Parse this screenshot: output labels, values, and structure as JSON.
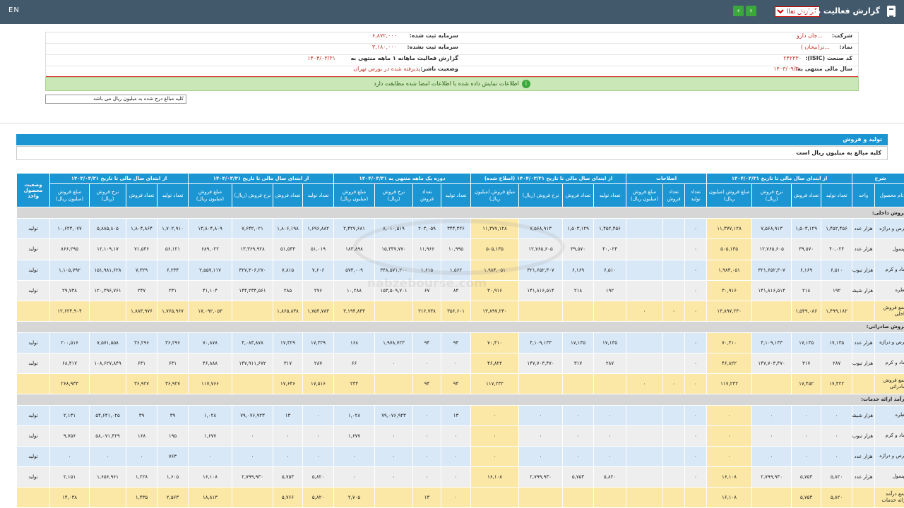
{
  "topbar": {
    "lang": "EN",
    "title": "گزارش فعالیت ماهانه",
    "report_select": "گزارش تغالیب",
    "prev": "‹",
    "next": "›"
  },
  "info": {
    "company_label": "شرکت:",
    "company_value": "...جان دارو",
    "capital_reg_label": "سرمایه ثبت شده:",
    "capital_reg_value": "۶,۸۷۲,۰۰۰",
    "symbol_label": "نماد:",
    "symbol_value": "...تر(بیجان )",
    "capital_unreg_label": "سرمایه ثبت نشده:",
    "capital_unreg_value": "۳,۱۸۰,۰۰۰",
    "isic_label": "کد صنعت (ISIC):",
    "isic_value": "۲۴۲۳۳۰",
    "report_label": "گزارش فعالیت ماهانه ۱ ماهه منتهی به",
    "report_value": "۱۴۰۴/۰۳/۳۱",
    "fy_label": "سال مالی منتهی به:",
    "fy_value": "۱۴۰۳/۰۹/۳۰",
    "status_label": "وضعیت ناشر:",
    "status_value": "پذیرفته شده در بورس تهران"
  },
  "alert": "اطلاعات نمایش داده شده با اطلاعات امضا شده مطابقت دارد",
  "note": "کلیه مبالغ درج شده به میلیون ریال می باشد",
  "section": {
    "title": "تولید و فروش",
    "subtitle": "کلیه مبالغ به میلیون ریال است"
  },
  "watermark": "nabzebourse.com",
  "table": {
    "groups": [
      "شرح",
      "از ابتدای سال مالی تا تاریخ ۱۴۰۴/۰۳/۳۱",
      "اصلاحات",
      "از ابتدای سال مالی تا تاریخ ۱۴۰۴/۰۳/۳۱ (اصلاح شده)",
      "دوره یک ماهه منتهی به ۱۴۰۴/۰۳/۳۱",
      "از ابتدای سال مالی تا تاریخ ۱۴۰۴/۰۳/۳۱",
      "از ابتدای سال مالی تا تاریخ ۱۴۰۳/۰۳/۳۱",
      "وضعیت محصول واحد"
    ],
    "cols": [
      "نام محصول",
      "واحد",
      "تعداد تولید",
      "تعداد فروش",
      "نرخ فروش (ریال)",
      "مبلغ فروش (میلیون ریال)",
      "تعداد تولید",
      "تعداد فروش",
      "مبلغ فروش (میلیون ریال)",
      "تعداد تولید",
      "تعداد فروش",
      "نرخ فروش (ریال)",
      "مبلغ فروش (میلیون ریال)",
      "تعداد تولید",
      "تعداد فروش",
      "نرخ فروش (ریال)",
      "مبلغ فروش (میلیون ریال)",
      "تعداد تولید",
      "تعداد فروش",
      "نرخ فروش (ریال)",
      "مبلغ فروش (میلیون ریال)",
      "تعداد تولید",
      "تعداد فروش",
      "نرخ فروش (ریال)",
      "مبلغ فروش (میلیون ریال)",
      ""
    ],
    "rows": [
      {
        "k": "grp",
        "c": [
          "فروش داخلی:"
        ]
      },
      {
        "k": "r1",
        "c": [
          "قرص و دراژه",
          "هزار عدد",
          "۱,۴۵۲,۴۵۶",
          "۱,۵۰۳,۱۲۹",
          "۷,۵۶۸,۹۱۳",
          "۱۱,۳۷۷,۱۲۸",
          "۰",
          "",
          "",
          "۱,۴۵۲,۴۵۶",
          "۱,۵۰۳,۱۲۹",
          "۷,۵۶۸,۹۱۳",
          "۱۱,۳۷۷,۱۲۸",
          "۳۴۴,۴۲۶",
          "۲۰۳,۰۵۹",
          "۸,۰۱۰,۵۱۹",
          "۲,۴۲۷,۶۸۱",
          "۱,۶۹۶,۸۸۲",
          "۱,۸۰۶,۱۹۸",
          "۷,۶۴۲,۰۲۱",
          "۱۳,۸۰۴,۸۰۹",
          "۱,۷۰۲,۹۱۰",
          "۱,۸۰۴,۸۶۴",
          "۵,۸۸۵,۸۰۵",
          "۱۰,۶۲۳,۰۷۷",
          "تولید"
        ]
      },
      {
        "k": "r2",
        "c": [
          "کپسول",
          "هزار عدد",
          "۴۰,۰۲۴",
          "۳۹,۵۷۰",
          "۱۲,۷۶۵,۶۰۵",
          "۵۰۵,۱۳۵",
          "۰",
          "",
          "",
          "۴۰,۰۲۴",
          "۳۹,۵۷۰",
          "۱۲,۷۶۵,۶۰۵",
          "۵۰۵,۱۳۵",
          "۱۰,۹۹۵",
          "۱۱,۹۶۶",
          "۱۵,۳۳۷,۷۷۰",
          "۱۸۳,۸۹۸",
          "۵۱,۰۱۹",
          "۵۱,۵۳۴",
          "۱۳,۳۶۹,۹۲۸",
          "۶۸۹,۰۲۲",
          "۵۶,۱۲۱",
          "۷۱,۵۳۶",
          "۱۲,۱۰۹,۱۷",
          "۸۶۶,۲۹۵",
          "تولید"
        ]
      },
      {
        "k": "r1",
        "c": [
          "پماد و کرم",
          "هزار تیوپ",
          "۶,۵۱۰",
          "۶,۱۶۹",
          "۳۲۱,۶۵۲,۳۰۷",
          "۱,۹۸۴,۰۵۱",
          "۰",
          "",
          "",
          "۶,۵۱۰",
          "۶,۱۶۹",
          "۳۲۱,۶۵۲,۳۰۷",
          "۱,۹۸۴,۰۵۱",
          "۱,۵۶۲",
          "۱,۶۱۵",
          "۳۴۸,۵۷۱,۲۰۰",
          "۵۷۳,۰۰۹",
          "۷,۶۰۶",
          "۷,۸۱۵",
          "۳۲۷,۳۰۶,۲۷۰",
          "۲,۵۵۷,۱۱۷",
          "۶,۲۳۴",
          "۷,۳۲۹",
          "۱۵۱,۹۸۱,۶۲۸",
          "۱,۱۰۵,۷۹۲",
          "تولید"
        ]
      },
      {
        "k": "r2",
        "c": [
          "قطره",
          "هزار شیشه",
          "۱۹۲",
          "۲۱۸",
          "۱۴۱,۸۱۶,۵۱۴",
          "۳۰,۹۱۶",
          "۰",
          "",
          "",
          "۱۹۲",
          "۲۱۸",
          "۱۴۱,۸۱۶,۵۱۴",
          "۳۰,۹۱۶",
          "۸۴",
          "۶۷",
          "۱۵۳,۵۰۹,۷۰۱",
          "۱۰,۲۸۸",
          "۲۷۶",
          "۲۸۵",
          "۱۴۴,۲۳۴,۵۶۱",
          "۴۱,۱۰۴",
          "۲۳۱",
          "۲۴۷",
          "۱۲۰,۳۹۶,۷۶۱",
          "۲۹,۷۳۸",
          "تولید"
        ]
      },
      {
        "k": "sum",
        "c": [
          "جمع فروش داخلی",
          "",
          "۱,۴۹۹,۱۸۲",
          "۱,۵۴۹,۰۸۶",
          "",
          "۱۳,۸۹۷,۲۳۰",
          "۰",
          "۰",
          "۰",
          "",
          "",
          "",
          "۱۳,۸۹۷,۲۳۰",
          "۳۵۶,۶۰۱",
          "۲۱۶,۷۳۸",
          "",
          "۳,۱۹۴,۸۳۳",
          "۱,۷۵۴,۷۸۳",
          "۱,۸۶۵,۸۳۸",
          "",
          "۱۷,۰۹۲,۰۵۳",
          "۱,۷۶۵,۹۶۷",
          "۱,۸۸۳,۹۷۶",
          "",
          "۱۲,۶۲۴,۹۰۴",
          ""
        ]
      },
      {
        "k": "grp",
        "c": [
          "فروش صادراتی:"
        ]
      },
      {
        "k": "r1",
        "c": [
          "قرص و دراژه",
          "هزار عدد",
          "۱۷,۱۳۵",
          "۱۷,۱۳۵",
          "۴,۱۰۹,۱۳۳",
          "۷۰,۴۱۰",
          "۰",
          "",
          "",
          "۱۷,۱۳۵",
          "۱۷,۱۳۵",
          "۴,۱۰۹,۱۳۳",
          "۷۰,۴۱۰",
          "۹۴",
          "۹۴",
          "۱,۹۷۸,۷۲۳",
          "۱۶۸",
          "۱۷,۳۲۹",
          "۱۷,۳۲۹",
          "۴,۰۸۳,۸۷۸",
          "۷۰,۸۷۸",
          "۳۶,۲۹۶",
          "۳۶,۲۹۶",
          "۷,۵۷۱,۵۵۸",
          "۲۰۰,۵۱۶",
          "تولید"
        ]
      },
      {
        "k": "r2",
        "c": [
          "پماد و کرم",
          "هزار تیوپ",
          "۲۸۷",
          "۳۱۷",
          "۱۴۷,۷۰۳,۴۷۰",
          "۴۶,۸۲۲",
          "۰",
          "",
          "",
          "۲۸۷",
          "۳۱۷",
          "۱۴۷,۷۰۳,۴۷۰",
          "۴۶,۸۲۲",
          "۰",
          "۰",
          "۰",
          "۶۶",
          "۲۸۷",
          "۳۱۷",
          "۱۴۷,۹۱۱,۶۷۲",
          "۴۶,۸۸۸",
          "۶۳۱",
          "۶۳۱",
          "۱۰۸,۶۲۷,۸۴۹",
          "۶۸,۴۱۷",
          "تولید"
        ]
      },
      {
        "k": "sum",
        "c": [
          "جمع فروش صادراتی",
          "",
          "۱۷,۴۲۲",
          "۱۷,۴۵۲",
          "",
          "۱۱۷,۲۳۲",
          "۰",
          "۰",
          "۰",
          "",
          "",
          "",
          "۱۱۷,۲۳۲",
          "۹۴",
          "۹۴",
          "",
          "۲۳۴",
          "۱۷,۵۱۶",
          "۱۷,۶۴۶",
          "",
          "۱۱۷,۷۶۶",
          "۳۶,۹۲۷",
          "۳۶,۹۲۷",
          "",
          "۲۶۸,۹۳۳",
          ""
        ]
      },
      {
        "k": "grp",
        "c": [
          "درآمد ارائه خدمات:"
        ]
      },
      {
        "k": "r1",
        "c": [
          "قطره",
          "هزار شیشه",
          "۰",
          "۰",
          "۰",
          "۰",
          "۰",
          "",
          "",
          "۰",
          "۰",
          "۰",
          "۰",
          "۱۳",
          "۰",
          "۷۹,۰۷۶,۹۲۳",
          "۱,۰۲۸",
          "۰",
          "۱۳",
          "۷۹,۰۷۶,۹۲۳",
          "۱,۰۲۸",
          "۳۹",
          "۳۹",
          "۵۴,۶۴۱,۰۲۵",
          "۲,۱۳۱",
          "تولید"
        ]
      },
      {
        "k": "r2",
        "c": [
          "پماد و کرم",
          "هزار تیوپ",
          "۰",
          "۰",
          "۰",
          "۰",
          "۰",
          "",
          "",
          "۰",
          "۰",
          "۰",
          "۰",
          "۰",
          "۰",
          "۰",
          "۱,۶۷۷",
          "۰",
          "۰",
          "۰",
          "۱,۶۷۷",
          "۱۹۵",
          "۱۶۸",
          "۵۸,۰۷۱,۴۲۹",
          "۹,۷۵۶",
          "تولید"
        ]
      },
      {
        "k": "r1",
        "c": [
          "قرص و دراژه",
          "هزار عدد",
          "۰",
          "۰",
          "۰",
          "۰",
          "۰",
          "",
          "",
          "۰",
          "۰",
          "۰",
          "۰",
          "۰",
          "۰",
          "۰",
          "۰",
          "۰",
          "۰",
          "۰",
          "۰",
          "۷۶۳",
          "۰",
          "۰",
          "۰",
          "تولید"
        ]
      },
      {
        "k": "r2",
        "c": [
          "کپسول",
          "هزار عدد",
          "۵,۸۲۰",
          "۵,۷۵۳",
          "۲,۷۹۹,۹۳۰",
          "۱۶,۱۰۸",
          "۰",
          "",
          "",
          "۵,۸۲۰",
          "۵,۷۵۳",
          "۲,۷۹۹,۹۳۰",
          "۱۶,۱۰۸",
          "۰",
          "۰",
          "۰",
          "۰",
          "۵,۸۲۰",
          "۵,۷۵۳",
          "۲,۷۹۹,۹۳۰",
          "۱۶,۱۰۸",
          "۱,۶۰۵",
          "۱,۲۲۸",
          "۱,۶۵۶,۹۶۱",
          "۲,۱۵۱",
          "تولید"
        ]
      },
      {
        "k": "sum",
        "c": [
          "جمع درآمد ارائه خدمات",
          "",
          "۵,۸۲۰",
          "۵,۷۵۳",
          "",
          "۱۶,۱۰۸",
          "",
          "",
          "",
          "",
          "",
          "",
          "",
          "۰",
          "۱۳",
          "",
          "۲,۷۰۵",
          "۵,۸۲۰",
          "۵,۷۶۶",
          "",
          "۱۸,۸۱۳",
          "۲,۵۶۳",
          "۱,۴۳۵",
          "",
          "۱۴,۰۳۸",
          ""
        ]
      }
    ]
  }
}
